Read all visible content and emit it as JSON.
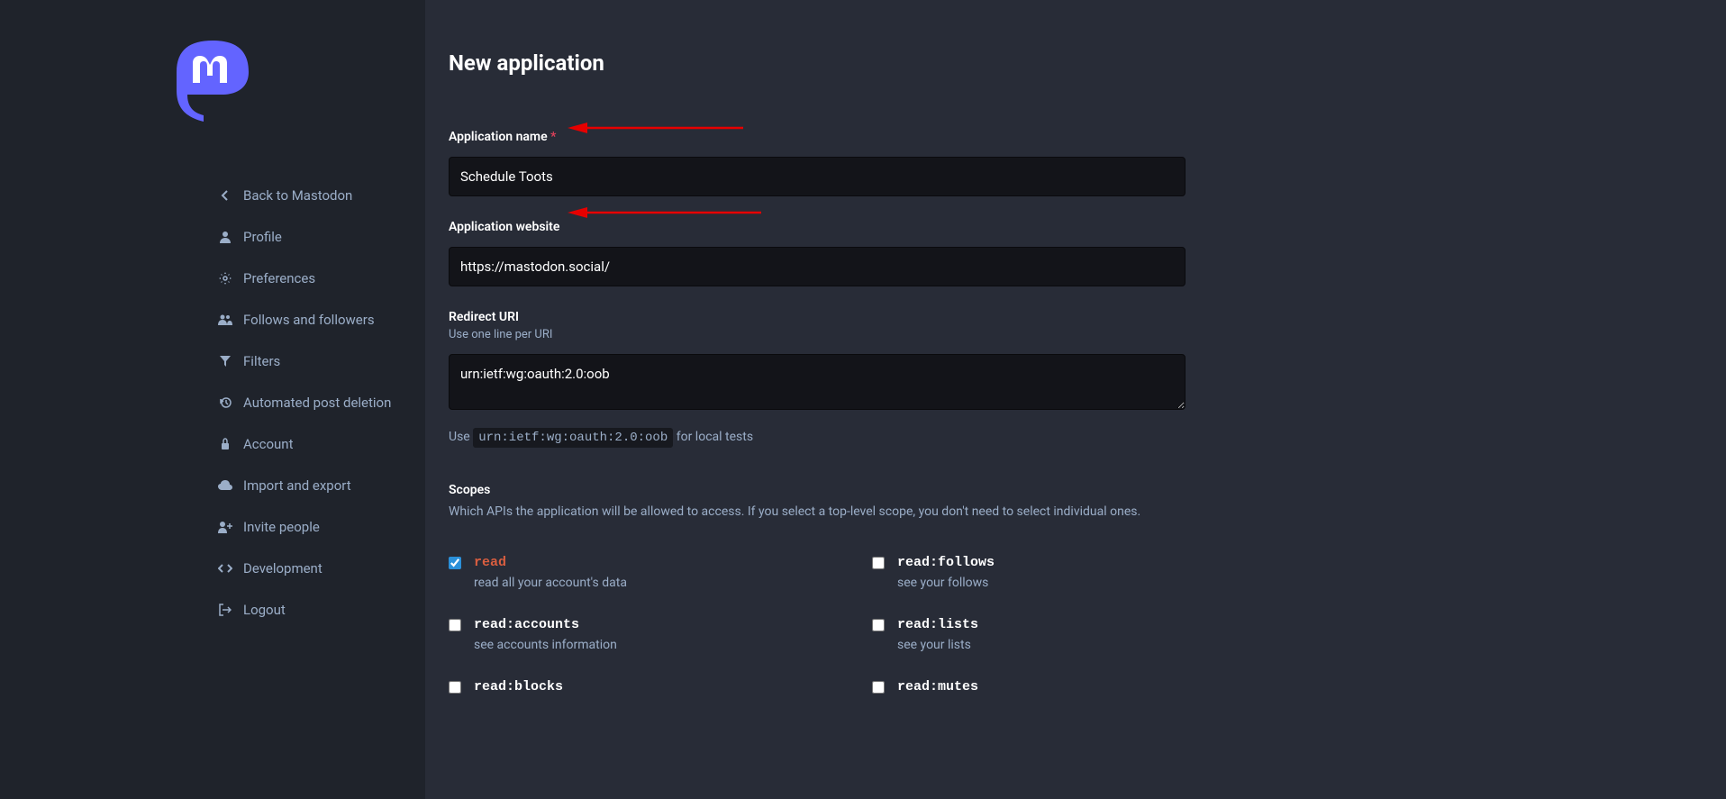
{
  "sidebar": {
    "items": [
      {
        "label": "Back to Mastodon",
        "icon": "chevron-left"
      },
      {
        "label": "Profile",
        "icon": "user"
      },
      {
        "label": "Preferences",
        "icon": "gear"
      },
      {
        "label": "Follows and followers",
        "icon": "users"
      },
      {
        "label": "Filters",
        "icon": "filter"
      },
      {
        "label": "Automated post deletion",
        "icon": "history"
      },
      {
        "label": "Account",
        "icon": "lock"
      },
      {
        "label": "Import and export",
        "icon": "cloud"
      },
      {
        "label": "Invite people",
        "icon": "user-plus"
      },
      {
        "label": "Development",
        "icon": "code"
      },
      {
        "label": "Logout",
        "icon": "sign-out"
      }
    ]
  },
  "page": {
    "title": "New application"
  },
  "fields": {
    "app_name": {
      "label": "Application name",
      "required": "*",
      "value": "Schedule Toots"
    },
    "app_website": {
      "label": "Application website",
      "value": "https://mastodon.social/"
    },
    "redirect_uri": {
      "label": "Redirect URI",
      "hint": "Use one line per URI",
      "value": "urn:ietf:wg:oauth:2.0:oob",
      "post_hint_prefix": "Use ",
      "post_hint_code": "urn:ietf:wg:oauth:2.0:oob",
      "post_hint_suffix": " for local tests"
    }
  },
  "scopes": {
    "title": "Scopes",
    "hint": "Which APIs the application will be allowed to access. If you select a top-level scope, you don't need to select individual ones.",
    "left": [
      {
        "name": "read",
        "desc": "read all your account's data",
        "checked": true,
        "highlighted": true
      },
      {
        "name": "read:accounts",
        "desc": "see accounts information",
        "checked": false
      },
      {
        "name": "read:blocks",
        "desc": "",
        "checked": false
      }
    ],
    "right": [
      {
        "name": "read:follows",
        "desc": "see your follows",
        "checked": false
      },
      {
        "name": "read:lists",
        "desc": "see your lists",
        "checked": false
      },
      {
        "name": "read:mutes",
        "desc": "",
        "checked": false
      }
    ]
  }
}
